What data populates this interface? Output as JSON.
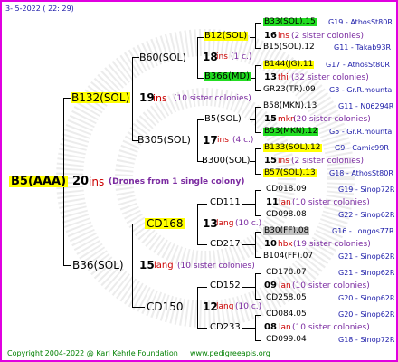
{
  "header": {
    "date": "3-  5-2022 ( 22:  29)"
  },
  "root": {
    "name": "B5(AAA)",
    "ins": "20",
    "ins_word": "ins",
    "drones": "(Drones from 1 single colony)"
  },
  "father": {
    "name": "B132(SOL)",
    "ins": "19",
    "ins_word": "ins",
    "note": "(10 sister colonies)",
    "b60": {
      "name": "B60(SOL)",
      "ins": "18",
      "ins_word": "ins",
      "note": "(1 c.)",
      "b12": {
        "name": "B12(SOL)",
        "c1": "B33(SOL).15",
        "c1r": "G19 - AthosSt80R",
        "ins": "16",
        "ins_word": "ins",
        "note": "(2 sister colonies)",
        "c2": "B15(SOL).12",
        "c2r": "G11 - Takab93R"
      },
      "b366": {
        "name": "B366(MD)",
        "c1": "B144(JG).11",
        "c1r": "G17 - AthosSt80R",
        "ins": "13",
        "ins_word": "thi",
        "note": "(32 sister colonies)",
        "c2": "GR23(TR).09",
        "c2r": "G3 - Gr.R.mounta"
      }
    },
    "b305": {
      "name": "B305(SOL)",
      "ins": "17",
      "ins_word": "ins",
      "note": "(4 c.)",
      "b5sol": {
        "name": "B5(SOL)",
        "c1": "B58(MKN).13",
        "c1r": "G11 - N06294R",
        "ins": "15",
        "ins_word": "mkn",
        "note": "(20 sister colonies)",
        "c2": "B53(MKN).12",
        "c2r": "G5 - Gr.R.mounta"
      },
      "b300": {
        "name": "B300(SOL)",
        "c1": "B133(SOL).12",
        "c1r": "G9 - Camic99R",
        "ins": "15",
        "ins_word": "ins",
        "note": "(2 sister colonies)",
        "c2": "B57(SOL).13",
        "c2r": "G18 - AthosSt80R"
      }
    }
  },
  "mother": {
    "name": "B36(SOL)",
    "ins": "15",
    "ins_word": "lang",
    "note": "(10 sister colonies)",
    "cd168": {
      "name": "CD168",
      "ins": "13",
      "ins_word": "lang",
      "note": "(10 c.)",
      "cd111": {
        "name": "CD111",
        "c1": "CD018.09",
        "c1r": "G19 - Sinop72R",
        "ins": "11",
        "ins_word": "lan",
        "note": "(10 sister colonies)",
        "c2": "CD098.08",
        "c2r": "G22 - Sinop62R"
      },
      "cd217": {
        "name": "CD217",
        "c1": "B30(FF).08",
        "c1r": "G16 - Longos77R",
        "ins": "10",
        "ins_word": "hbx",
        "note": "(19 sister colonies)",
        "c2": "B104(FF).07",
        "c2r": "G21 - Sinop62R"
      }
    },
    "cd150": {
      "name": "CD150",
      "ins": "12",
      "ins_word": "lang",
      "note": "(10 c.)",
      "cd152": {
        "name": "CD152",
        "c1": "CD178.07",
        "c1r": "G21 - Sinop62R",
        "ins": "09",
        "ins_word": "lan",
        "note": "(10 sister colonies)",
        "c2": "CD258.05",
        "c2r": "G20 - Sinop62R"
      },
      "cd233": {
        "name": "CD233",
        "c1": "CD084.05",
        "c1r": "G20 - Sinop62R",
        "ins": "08",
        "ins_word": "lan",
        "note": "(10 sister colonies)",
        "c2": "CD099.04",
        "c2r": "G18 - Sinop72R"
      }
    }
  },
  "footer": {
    "copyright": "Copyright 2004-2022 @ Karl Kehrle Foundation",
    "url": "www.pedigreeapis.org"
  },
  "colors": {
    "frame": "#e000e0",
    "highlight_yellow": "#ffff00",
    "highlight_green": "#22dd22",
    "highlight_gray": "#c0c0c0",
    "ref_blue": "#1a1aa8",
    "ins_red": "#cc0000",
    "footer_green": "#008000"
  }
}
